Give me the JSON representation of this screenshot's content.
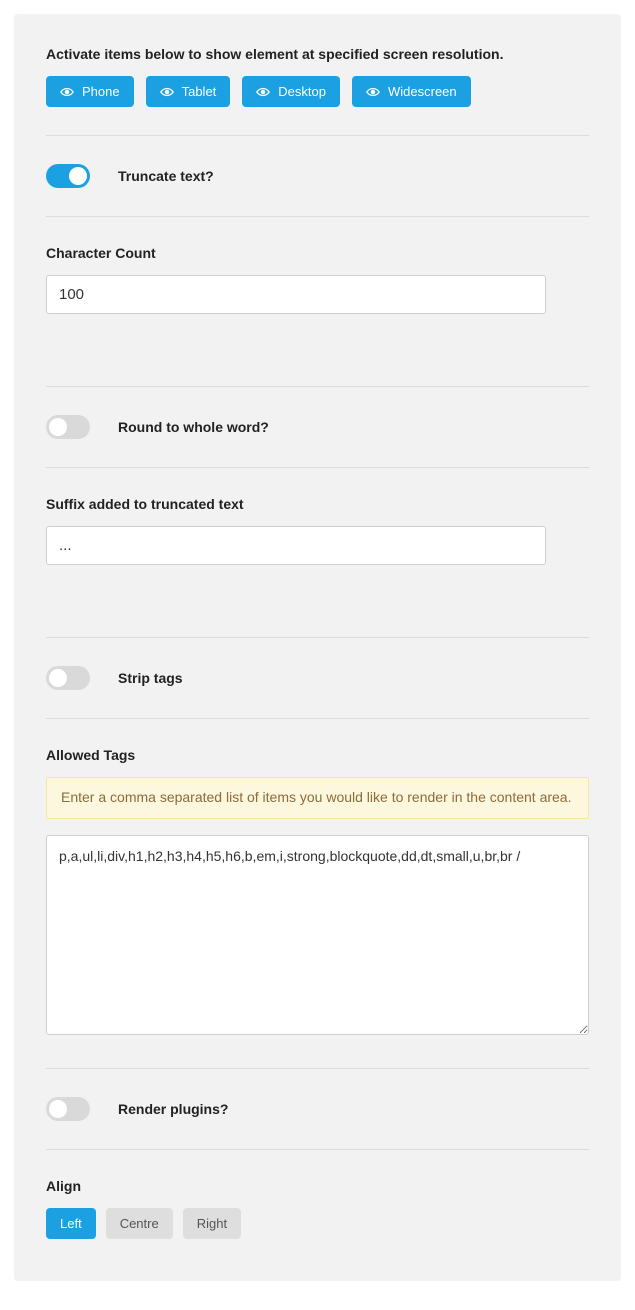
{
  "resolutions": {
    "intro": "Activate items below to show element at specified screen resolution.",
    "buttons": [
      "Phone",
      "Tablet",
      "Desktop",
      "Widescreen"
    ]
  },
  "truncate": {
    "label": "Truncate text?"
  },
  "character_count": {
    "label": "Character Count",
    "value": "100"
  },
  "round_word": {
    "label": "Round to whole word?"
  },
  "suffix": {
    "label": "Suffix added to truncated text",
    "value": "..."
  },
  "strip_tags": {
    "label": "Strip tags"
  },
  "allowed_tags": {
    "label": "Allowed Tags",
    "hint": "Enter a comma separated list of items you would like to render in the content area.",
    "value": "p,a,ul,li,div,h1,h2,h3,h4,h5,h6,b,em,i,strong,blockquote,dd,dt,small,u,br,br /"
  },
  "render_plugins": {
    "label": "Render plugins?"
  },
  "align": {
    "label": "Align",
    "options": [
      "Left",
      "Centre",
      "Right"
    ],
    "active": "Left"
  }
}
